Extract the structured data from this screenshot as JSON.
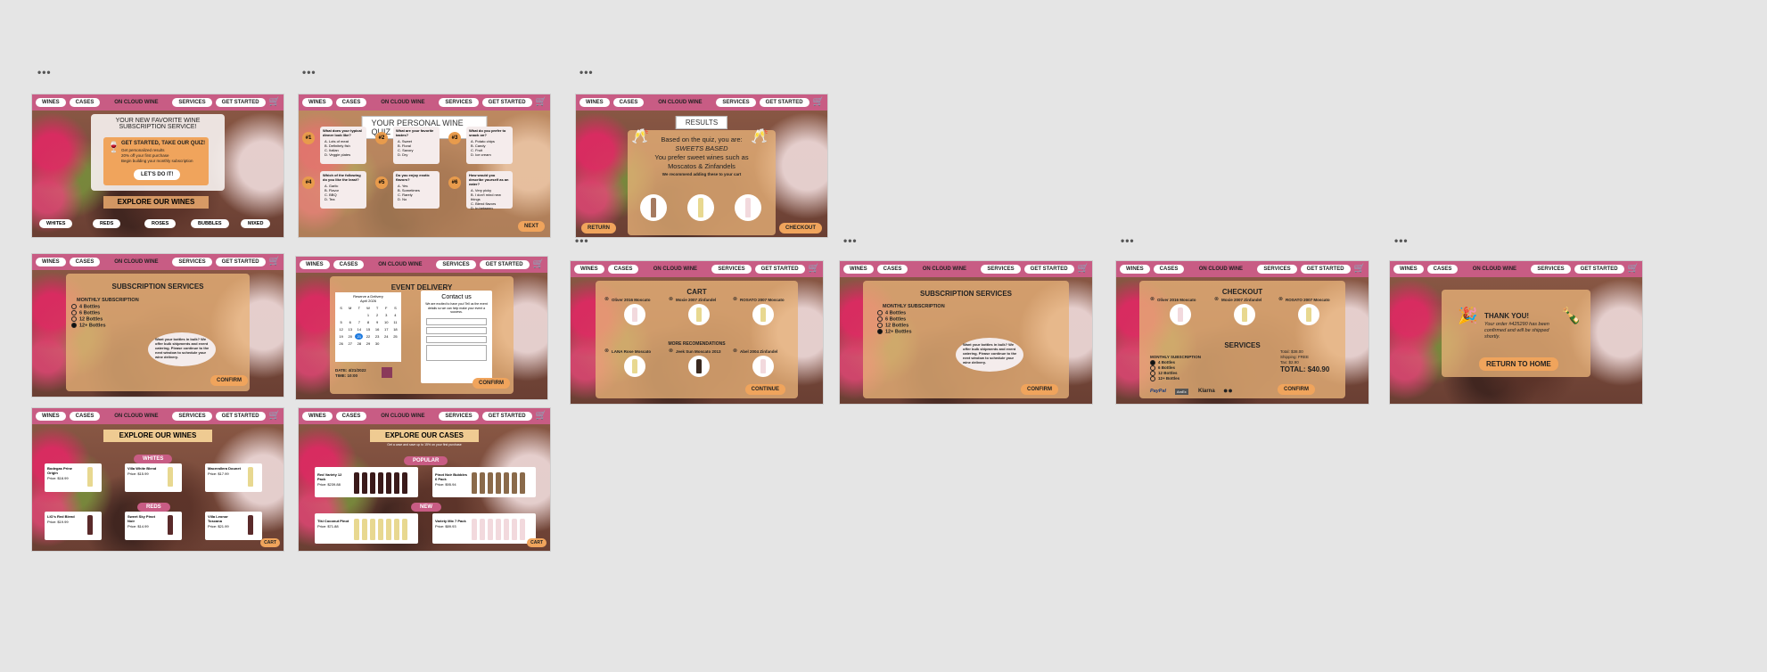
{
  "nav": {
    "wines": "WINES",
    "cases": "CASES",
    "logo": "ON CLOUD WINE",
    "services": "SERVICES",
    "get_started": "GET STARTED"
  },
  "home": {
    "headline": "YOUR NEW FAVORITE WINE SUBSCRIPTION SERVICE!",
    "box_title": "GET STARTED, TAKE OUR QUIZ!",
    "box_line1": "Get personalized results",
    "box_line2": "20% off your first purchase",
    "box_line3": "Begin building your monthly subscription",
    "cta": "LET'S DO IT!",
    "explore": "EXPLORE OUR WINES",
    "categories": [
      "WHITES",
      "REDS",
      "ROSES",
      "BUBBLES",
      "MIXED"
    ]
  },
  "quiz": {
    "title": "YOUR PERSONAL WINE QUIZ",
    "questions": [
      {
        "num": "#1",
        "q": "What does your typical dinner look like?",
        "opts": [
          "A. Lots of meat",
          "B. Definitely fish",
          "C. Italian",
          "D. Veggie plates"
        ]
      },
      {
        "num": "#2",
        "q": "What are your favorite tastes?",
        "opts": [
          "A. Sweet",
          "B. Floral",
          "C. Savory",
          "D. Dry"
        ]
      },
      {
        "num": "#3",
        "q": "What do you prefer to snack on?",
        "opts": [
          "A. Potato chips",
          "B. Candy",
          "C. Fruit",
          "D. Ice cream"
        ]
      },
      {
        "num": "#4",
        "q": "Which of the following do you like the least?",
        "opts": [
          "A. Garlic",
          "B. Flavor",
          "C. BBQ",
          "D. Tea"
        ]
      },
      {
        "num": "#5",
        "q": "Do you enjoy exotic flavors?",
        "opts": [
          "A. Yes",
          "B. Sometimes",
          "C. Rarely",
          "D. No"
        ]
      },
      {
        "num": "#6",
        "q": "How would you describe yourself as an eater?",
        "opts": [
          "A. Very picky",
          "B. I don't mind new things",
          "C. Blend flavors",
          "D. In between"
        ]
      }
    ],
    "next": "NEXT"
  },
  "results": {
    "title": "RESULTS",
    "line1": "Based on the quiz, you are:",
    "line2": "SWEETS BASED",
    "line3": "You prefer sweet wines such as",
    "line4": "Moscatos & Zinfandels",
    "line5": "We recommend adding these to your cart",
    "return": "RETURN",
    "checkout": "CHECKOUT"
  },
  "subscription": {
    "title": "SUBSCRIPTION SERVICES",
    "monthly": "MONTHLY SUBSCRIPTION",
    "options": [
      "4 Bottles",
      "6 Bottles",
      "12 Bottles",
      "12+ Bottles"
    ],
    "bubble": "Want your bottles in bulk? We offer bulk shipments and event catering. Please continue to the next window to schedule your wine delivery.",
    "confirm": "CONFIRM"
  },
  "event": {
    "title": "EVENT DELIVERY",
    "cal_title": "Reserve a Delivery",
    "cal_month": "April 2026",
    "days": [
      "S",
      "M",
      "T",
      "W",
      "T",
      "F",
      "S"
    ],
    "dates": [
      "",
      "",
      "",
      "1",
      "2",
      "3",
      "4",
      "5",
      "6",
      "7",
      "8",
      "9",
      "10",
      "11",
      "12",
      "13",
      "14",
      "15",
      "16",
      "17",
      "18",
      "19",
      "20",
      "21",
      "22",
      "23",
      "24",
      "25",
      "26",
      "27",
      "28",
      "29",
      "30"
    ],
    "date_label": "DATE: 4/21/2022",
    "time_label": "TIME: 10:00",
    "contact_title": "Contact us",
    "contact_text": "We are excited to have you! Tell us the event details so we can help make your event a success.",
    "confirm": "CONFIRM"
  },
  "cart": {
    "title": "CART",
    "items": [
      "Oliver 2016 Moscato",
      "Moxie 2007 Zinfandel",
      "ROSATO 2007 Moscato"
    ],
    "more": "MORE RECOMENDATIONS",
    "recs": [
      "LANA Rose Moscato",
      "Jeek Sun Moscato 2013",
      "Abel 2004 Zinfandel"
    ],
    "continue": "CONTINUE"
  },
  "checkout": {
    "title": "CHECKOUT",
    "items": [
      "Oliver 2016 Moscato",
      "Moxie 2007 Zinfandel",
      "ROSATO 2007 Moscato"
    ],
    "services": "SERVICES",
    "monthly": "MONTHLY SUBSCRIPTION",
    "options": [
      "4 Bottles",
      "6 Bottles",
      "12 Bottles",
      "12+ Bottles"
    ],
    "subtotal": "Total: $38.00",
    "shipping": "Shipping: FREE",
    "tax": "Tax: $2.90",
    "total": "TOTAL: $40.90",
    "confirm": "CONFIRM",
    "payments": [
      "PayPal",
      "AmEx",
      "Klarna",
      "Mastercard"
    ]
  },
  "thanks": {
    "title": "THANK YOU!",
    "line": "Your order #425290 has been confirmed and will be shipped shortly.",
    "button": "RETURN TO HOME"
  },
  "wines": {
    "title": "EXPLORE OUR WINES",
    "whites": "WHITES",
    "reds": "REDS",
    "cart": "CART",
    "white_items": [
      {
        "name": "Bodegas Prine Origin",
        "price": "Price: $18.99"
      },
      {
        "name": "Villa White Blend",
        "price": "Price: $15.99"
      },
      {
        "name": "Macerallera Dounet",
        "price": "Price: $17.99"
      }
    ],
    "red_items": [
      {
        "name": "LIO's Red Blend",
        "price": "Price: $19.99"
      },
      {
        "name": "Sweet Sky Pinot Noir",
        "price": "Price: $14.99"
      },
      {
        "name": "Villa Leonor Toscana",
        "price": "Price: $21.99"
      }
    ]
  },
  "cases": {
    "title": "EXPLORE OUR CASES",
    "subtitle": "Get a case and save up to 15% on your first purchase",
    "popular": "POPULAR",
    "new": "NEW",
    "cart": "CART",
    "items": [
      {
        "name": "Red Variety 12 Pack",
        "price": "Price: $239.88"
      },
      {
        "name": "Pinot Noir Bubbles 6 Pack",
        "price": "Price: $95.94"
      },
      {
        "name": "Tiki Coconut Pinot",
        "price": "Price: $71.88"
      },
      {
        "name": "Variety Mix 7 Pack",
        "price": "Price: $89.93"
      }
    ]
  }
}
